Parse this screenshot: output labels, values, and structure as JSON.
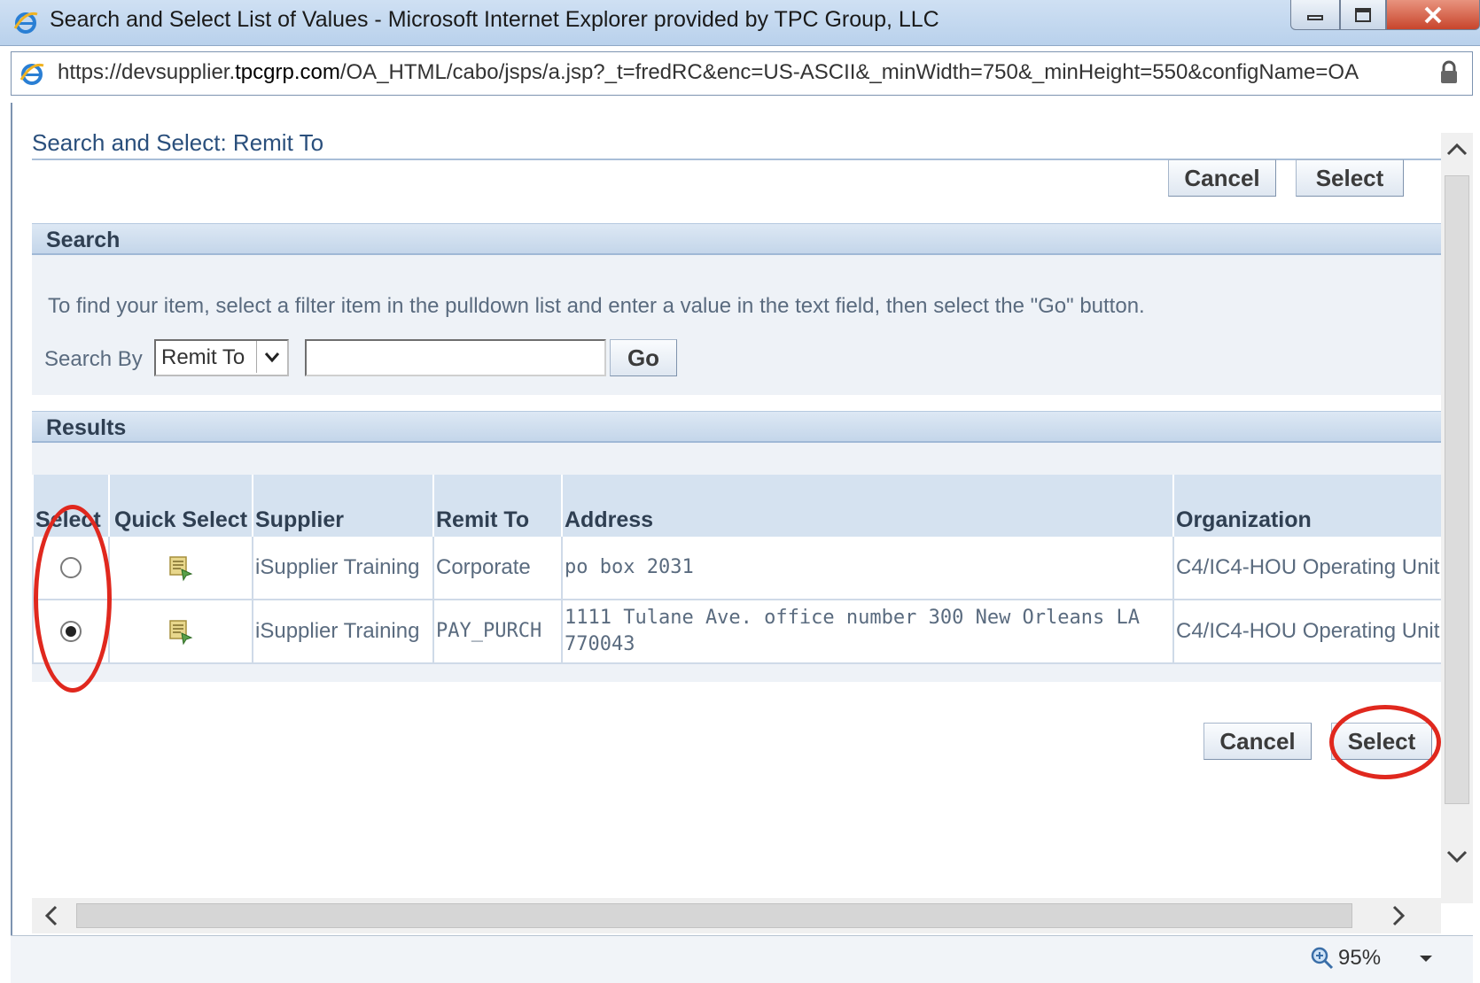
{
  "window": {
    "title": "Search and Select List of Values - Microsoft Internet Explorer provided by TPC Group, LLC",
    "url_prefix": "https://devsupplier.",
    "url_host": "tpcgrp.com",
    "url_rest": "/OA_HTML/cabo/jsps/a.jsp?_t=fredRC&enc=US-ASCII&_minWidth=750&_minHeight=550&configName=OA"
  },
  "page": {
    "title": "Search and Select: Remit To",
    "cancel_label": "Cancel",
    "select_label": "Select"
  },
  "search": {
    "header": "Search",
    "instructions": "To find your item, select a filter item in the pulldown list and enter a value in the text field, then select the \"Go\" button.",
    "search_by_label": "Search By",
    "selected_filter": "Remit To",
    "input_value": "",
    "go_label": "Go"
  },
  "results": {
    "header": "Results",
    "columns": {
      "select": "Select",
      "quick_select": "Quick Select",
      "supplier": "Supplier",
      "remit_to": "Remit To",
      "address": "Address",
      "organization": "Organization"
    },
    "rows": [
      {
        "selected": false,
        "supplier": "iSupplier Training",
        "remit_to": "Corporate",
        "address": "po box 2031",
        "organization": "C4/IC4-HOU Operating Unit"
      },
      {
        "selected": true,
        "supplier": "iSupplier Training",
        "remit_to": "PAY_PURCH",
        "address": "1111 Tulane Ave. office number 300 New Orleans LA 770043",
        "organization": "C4/IC4-HOU Operating Unit"
      }
    ]
  },
  "status": {
    "zoom": "95%"
  },
  "colors": {
    "annotation": "#e0281e",
    "header_text": "#2f3f52",
    "link_title": "#2a4f7c"
  }
}
